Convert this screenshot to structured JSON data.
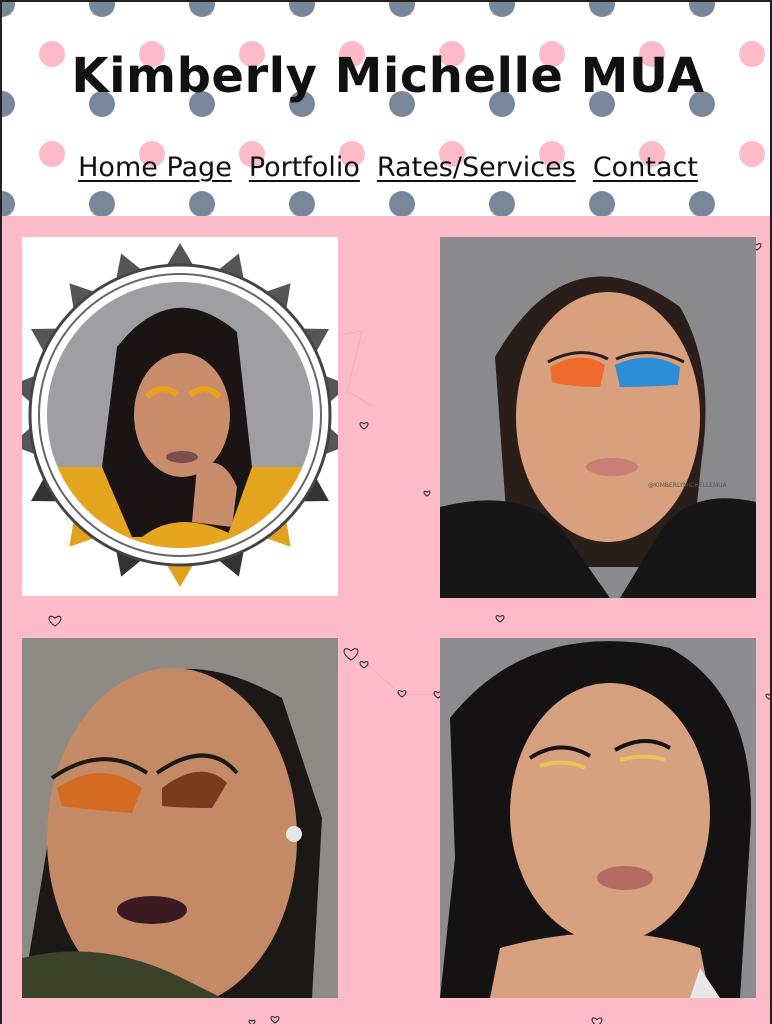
{
  "site": {
    "title": "Kimberly Michelle MUA"
  },
  "nav": {
    "items": [
      {
        "label": "Home Page"
      },
      {
        "label": "Portfolio"
      },
      {
        "label": "Rates/Services"
      },
      {
        "label": "Contact"
      }
    ]
  },
  "colors": {
    "gallery_background": "#fdbbc9",
    "dot_pink": "#fdbbc9",
    "dot_gray": "#78889a",
    "text": "#111111"
  },
  "gallery": {
    "photos": [
      {
        "name": "portfolio-photo-sunburst-frame"
      },
      {
        "name": "portfolio-photo-blue-orange-eyeshadow",
        "watermark": "@KIMBERLYMICHELLEMUA"
      },
      {
        "name": "portfolio-photo-dark-lip"
      },
      {
        "name": "portfolio-photo-curly-hair"
      }
    ]
  }
}
